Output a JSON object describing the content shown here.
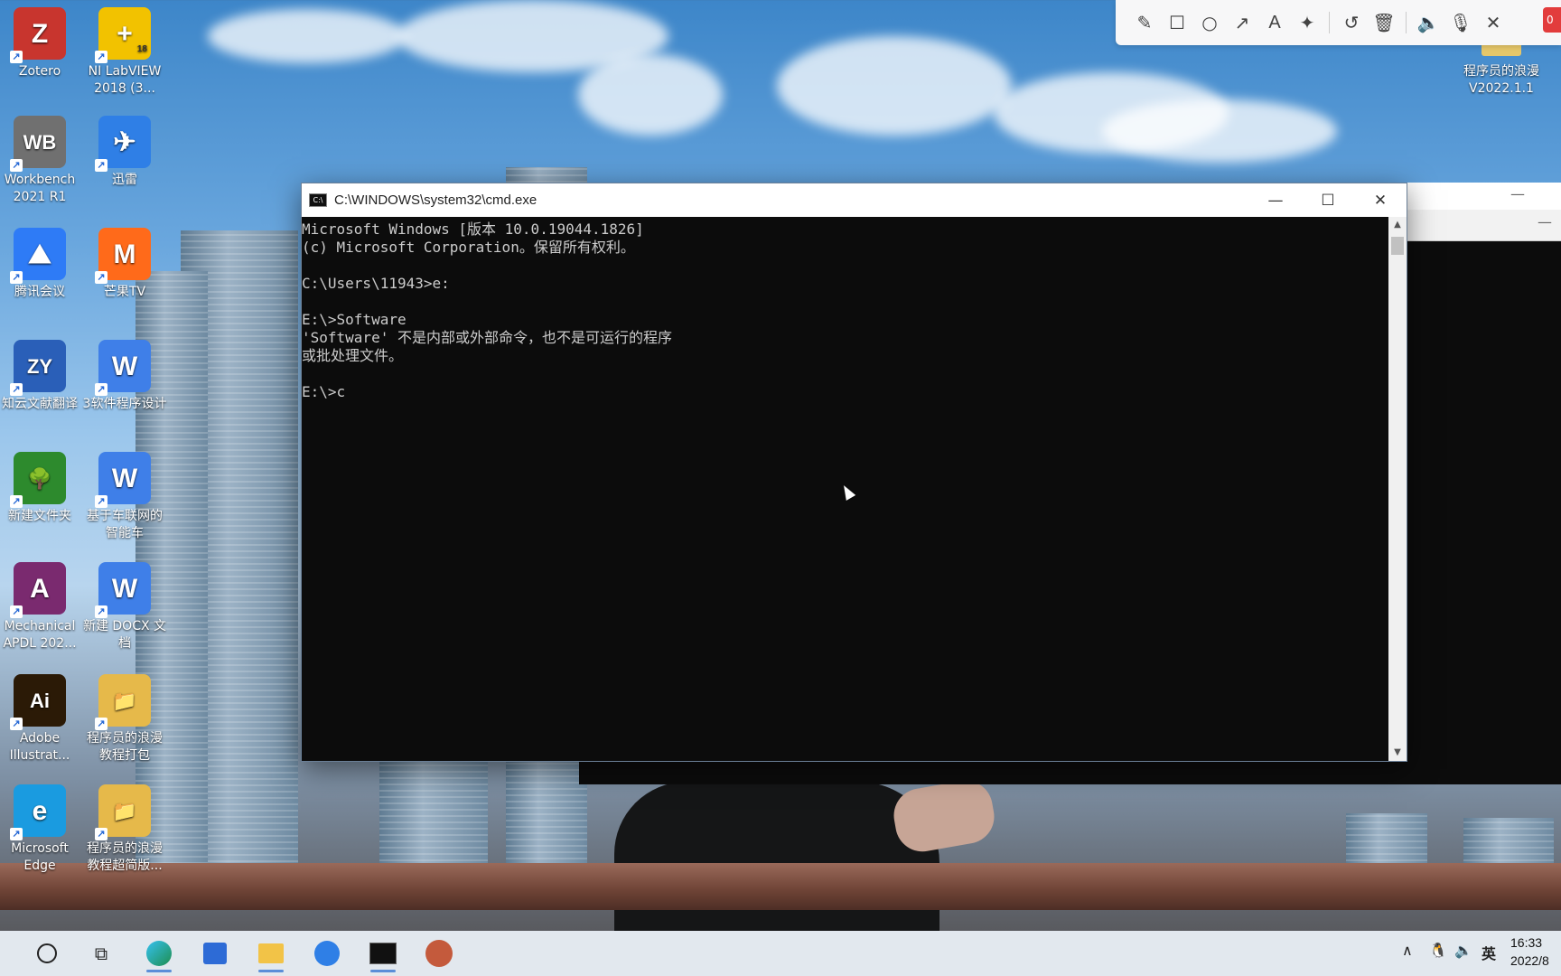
{
  "desktop": {
    "icons": [
      {
        "label": "Zotero",
        "tile": "Z",
        "color": "#c8352e",
        "icon": "zotero-icon"
      },
      {
        "label": "NI LabVIEW 2018 (3...",
        "tile": "+",
        "color": "#f2c200",
        "icon": "labview-icon",
        "badge": "18"
      },
      {
        "label": "Workbench 2021 R1",
        "tile": "WB",
        "color": "#707070",
        "icon": "workbench-icon"
      },
      {
        "label": "迅雷",
        "tile": "✈",
        "color": "#2f7fe6",
        "icon": "xunlei-icon"
      },
      {
        "label": "腾讯会议",
        "tile": "⛰",
        "color": "#2e7bf6",
        "icon": "tencent-meeting-icon"
      },
      {
        "label": "芒果TV",
        "tile": "M",
        "color": "#ff6a1a",
        "icon": "mango-tv-icon"
      },
      {
        "label": "知云文献翻译",
        "tile": "ZY",
        "color": "#2a5fb8",
        "icon": "zhiyun-icon"
      },
      {
        "label": "3软件程序设计",
        "tile": "W",
        "color": "#3f7fe8",
        "icon": "wps-doc-icon"
      },
      {
        "label": "新建文件夹",
        "tile": "🌳",
        "color": "#2d8a2d",
        "icon": "tree-folder-icon"
      },
      {
        "label": "基于车联网的智能车",
        "tile": "W",
        "color": "#3f7fe8",
        "icon": "wps-doc-icon"
      },
      {
        "label": "Mechanical APDL 202...",
        "tile": "A",
        "color": "#7a2a6f",
        "icon": "ansys-apdl-icon"
      },
      {
        "label": "新建 DOCX 文档",
        "tile": "W",
        "color": "#3f7fe8",
        "icon": "wps-doc-icon"
      },
      {
        "label": "Adobe Illustrat...",
        "tile": "Ai",
        "color": "#2b1a06",
        "icon": "illustrator-icon"
      },
      {
        "label": "程序员的浪漫教程打包",
        "tile": "📁",
        "color": "#e6b94a",
        "icon": "folder-icon"
      },
      {
        "label": "Microsoft Edge",
        "tile": "e",
        "color": "#1a9be0",
        "icon": "edge-icon"
      },
      {
        "label": "程序员的浪漫教程超简版...",
        "tile": "📁",
        "color": "#e6b94a",
        "icon": "folder-icon"
      }
    ],
    "top_right_folder": "程序员的浪漫V2022.1.1"
  },
  "cmd_window": {
    "title": "C:\\WINDOWS\\system32\\cmd.exe",
    "console_lines": [
      "Microsoft Windows [版本 10.0.19044.1826]",
      "(c) Microsoft Corporation。保留所有权利。",
      "",
      "C:\\Users\\11943>e:",
      "",
      "E:\\>Software",
      "'Software' 不是内部或外部命令，也不是可运行的程序",
      "或批处理文件。",
      "",
      "E:\\>c"
    ]
  },
  "annotation_toolbar": {
    "tools": [
      "pencil-icon",
      "rectangle-icon",
      "circle-icon",
      "arrow-icon",
      "text-icon",
      "magic-wand-icon",
      "undo-icon",
      "trash-icon",
      "speaker-icon",
      "microphone-icon",
      "close-icon"
    ],
    "record_badge": "0"
  },
  "taskbar": {
    "tray_lang": "英",
    "clock_time": "16:33",
    "clock_date": "2022/8"
  }
}
